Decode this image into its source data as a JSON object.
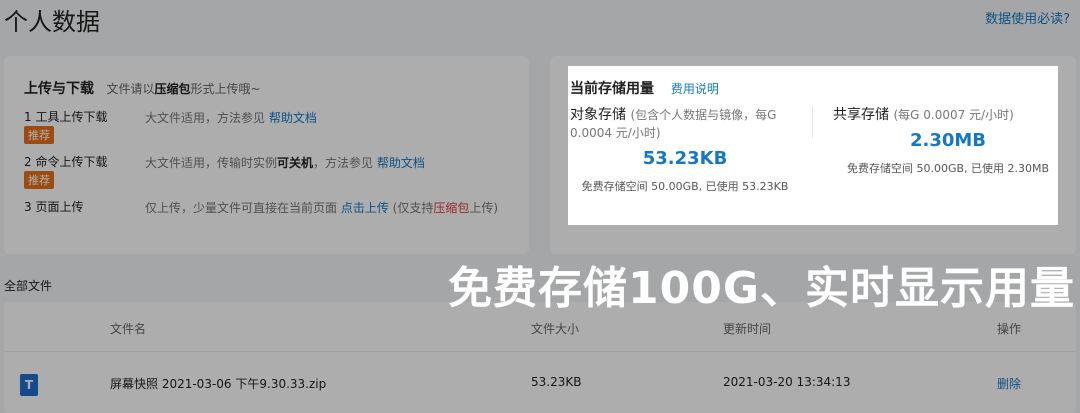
{
  "page": {
    "title": "个人数据",
    "top_link": "数据使用必读?"
  },
  "upload": {
    "title": "上传与下载",
    "sub_prefix": "文件请以",
    "sub_bold": "压缩包",
    "sub_suffix": "形式上传哦~",
    "rows": [
      {
        "name": "1 工具上传下载",
        "badge": "推荐",
        "desc_prefix": "大文件适用，方法参见 ",
        "link": "帮助文档"
      },
      {
        "name": "2 命令上传下载",
        "badge": "推荐",
        "desc_prefix": "大文件适用，传输时实例",
        "desc_bold": "可关机",
        "desc_mid": "，方法参见 ",
        "link": "帮助文档"
      },
      {
        "name": "3 页面上传",
        "desc_prefix": "仅上传，少量文件可直接在当前页面 ",
        "link": "点击上传",
        "desc_mid": " (仅支持",
        "desc_red": "压缩包",
        "desc_suffix": "上传)"
      }
    ]
  },
  "storage": {
    "title": "当前存储用量",
    "fee_link": "费用说明",
    "object": {
      "label": "对象存储",
      "hint": "(包含个人数据与镜像，每G 0.0004 元/小时)",
      "value": "53.23KB",
      "usage": "免费存储空间 50.00GB, 已使用 53.23KB"
    },
    "shared": {
      "label": "共享存储",
      "hint": "(每G 0.0007 元/小时)",
      "value": "2.30MB",
      "usage": "免费存储空间 50.00GB, 已使用 2.30MB"
    }
  },
  "overlay": "免费存储100G、实时显示用量",
  "files": {
    "section_title": "全部文件",
    "columns": [
      "文件名",
      "文件大小",
      "更新时间",
      "操作"
    ],
    "rows": [
      {
        "icon": "T",
        "name": "屏幕快照 2021-03-06 下午9.30.33.zip",
        "size": "53.23KB",
        "updated": "2021-03-20 13:34:13",
        "action": "删除"
      }
    ]
  },
  "colors": {
    "link": "#1478c7",
    "badge": "#e8701a",
    "red": "#e43b3b"
  }
}
